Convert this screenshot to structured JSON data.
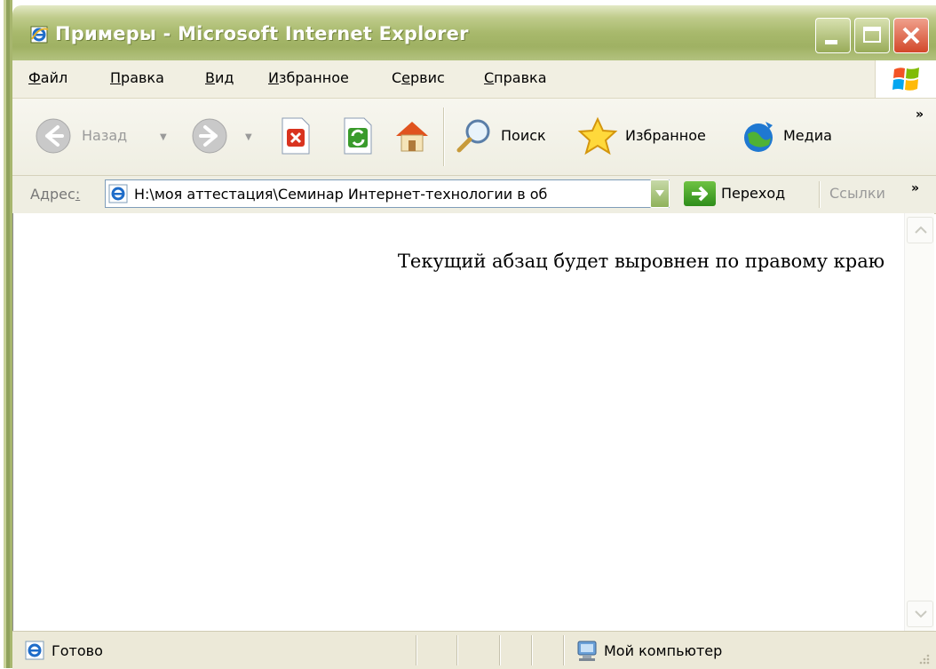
{
  "window": {
    "title": "Примеры - Microsoft Internet Explorer"
  },
  "menu": {
    "items": [
      {
        "acc": "Ф",
        "rest": "айл"
      },
      {
        "acc": "П",
        "rest": "равка"
      },
      {
        "acc": "В",
        "rest": "ид"
      },
      {
        "acc": "И",
        "rest": "збранное"
      },
      {
        "pre": "С",
        "acc": "е",
        "rest": "рвис"
      },
      {
        "acc": "С",
        "rest": "правка"
      }
    ]
  },
  "toolbar": {
    "back_label": "Назад",
    "search_label": "Поиск",
    "favorites_label": "Избранное",
    "media_label": "Медиа",
    "more_label": "»"
  },
  "address": {
    "label_pre": "Адрес",
    "label_acc": ":",
    "value": "H:\\моя аттестация\\Семинар Интернет-технологии в об",
    "go_label": "Переход",
    "links_label": "Ссылки",
    "more_label": "»"
  },
  "content": {
    "paragraph": "Текущий абзац будет выровнен по правому краю"
  },
  "status": {
    "text": "Готово",
    "zone": "Мой компьютер"
  },
  "colors": {
    "titlebar": "#a8b96c",
    "close_button": "#d2482a",
    "go_button": "#2e8d1a"
  }
}
